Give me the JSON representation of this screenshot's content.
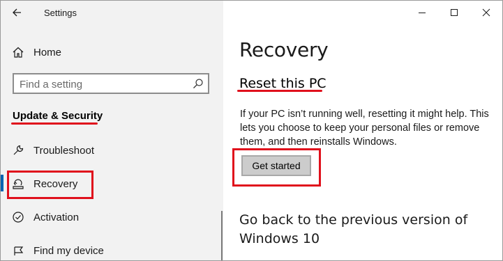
{
  "titlebar": {
    "back_icon": "back-arrow-icon",
    "app_title": "Settings"
  },
  "window_controls": {
    "minimize_icon": "minimize-icon",
    "maximize_icon": "maximize-icon",
    "close_icon": "close-icon"
  },
  "sidebar": {
    "home": {
      "label": "Home",
      "icon": "home-icon"
    },
    "search": {
      "placeholder": "Find a setting",
      "icon": "search-icon"
    },
    "section_heading": "Update & Security",
    "items": [
      {
        "label": "Troubleshoot",
        "icon": "wrench-icon",
        "selected": false
      },
      {
        "label": "Recovery",
        "icon": "recovery-icon",
        "selected": true
      },
      {
        "label": "Activation",
        "icon": "activation-icon",
        "selected": false
      },
      {
        "label": "Find my device",
        "icon": "find-device-icon",
        "selected": false
      }
    ]
  },
  "main": {
    "page_title": "Recovery",
    "reset": {
      "heading": "Reset this PC",
      "description": "If your PC isn’t running well, resetting it might help. This lets you choose to keep your personal files or remove them, and then reinstalls Windows.",
      "button_label": "Get started"
    },
    "go_back": {
      "heading": "Go back to the previous version of Windows 10"
    }
  },
  "colors": {
    "annotation_red": "#e0101c",
    "accent_blue": "#0063b1",
    "sidebar_bg": "#f2f2f2",
    "button_bg": "#cccccc"
  }
}
